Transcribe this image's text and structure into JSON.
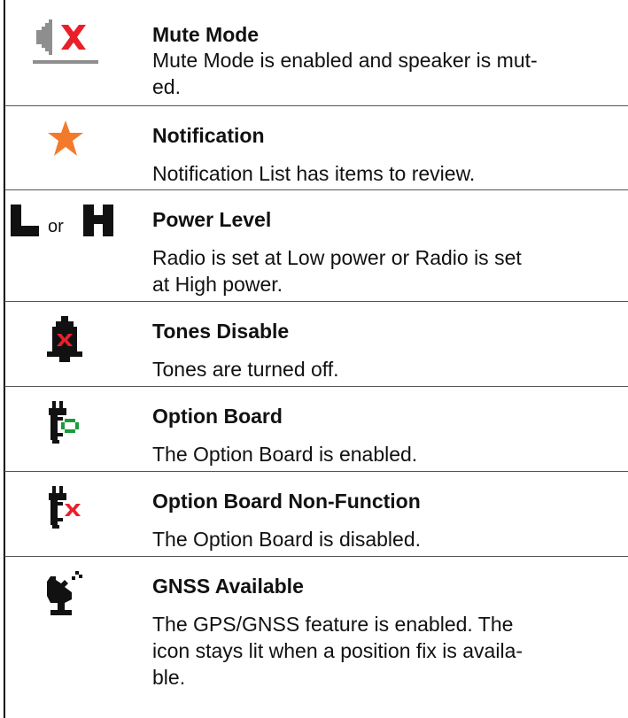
{
  "rows": [
    {
      "icon": "mute-mode-icon",
      "title": "Mute Mode",
      "description_lines": [
        "Mute Mode is enabled and speaker is mut-",
        "ed."
      ]
    },
    {
      "icon": "notification-icon",
      "title": "Notification",
      "description_lines": [
        "Notification List has items to review."
      ]
    },
    {
      "icon": "power-level-icon",
      "or_text": "or",
      "title": "Power Level",
      "description_lines": [
        "Radio is set at Low power or Radio is set",
        "at High power."
      ]
    },
    {
      "icon": "tones-disable-icon",
      "title": "Tones Disable",
      "description_lines": [
        "Tones are turned off."
      ]
    },
    {
      "icon": "option-board-icon",
      "title": "Option Board",
      "description_lines": [
        "The Option Board is enabled."
      ]
    },
    {
      "icon": "option-board-non-function-icon",
      "title": "Option Board Non-Function",
      "description_lines": [
        "The Option Board is disabled."
      ]
    },
    {
      "icon": "gnss-available-icon",
      "title": "GNSS Available",
      "description_lines": [
        "The GPS/GNSS feature is enabled. The",
        "icon stays lit when a position fix is availa-",
        "ble."
      ]
    }
  ],
  "colors": {
    "red": "#e8202a",
    "orange": "#f47a2b",
    "green": "#1a9b3c",
    "gray": "#8e8e8e",
    "black": "#111111"
  }
}
